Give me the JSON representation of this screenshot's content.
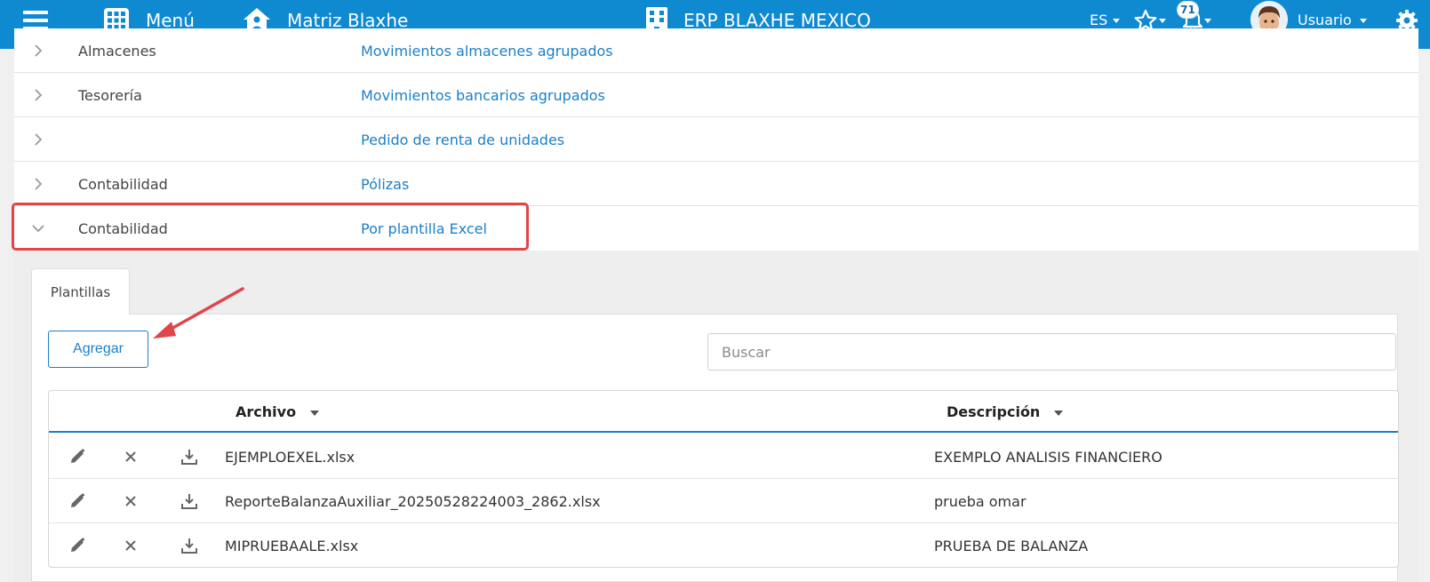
{
  "header": {
    "menu_label": "Menú",
    "company": "Matriz Blaxhe",
    "erp_title": "ERP BLAXHE MEXICO",
    "language": "ES",
    "notifications_count": "71",
    "user_label": "Usuario",
    "bar_color": "#0f89d0"
  },
  "menu_rows": [
    {
      "module": "Almacenes",
      "link": "Movimientos almacenes agrupados"
    },
    {
      "module": "Tesorería",
      "link": "Movimientos bancarios agrupados"
    },
    {
      "module": "",
      "link": "Pedido de renta de unidades"
    },
    {
      "module": "Contabilidad",
      "link": "Pólizas"
    },
    {
      "module": "Contabilidad",
      "link": "Por plantilla Excel",
      "expanded": true
    }
  ],
  "panel": {
    "tab_label": "Plantillas",
    "add_button": "Agregar",
    "search_placeholder": "Buscar"
  },
  "table": {
    "columns": [
      "Archivo",
      "Descripción"
    ],
    "rows": [
      {
        "archivo": "EJEMPLOEXEL.xlsx",
        "descripcion": "EXEMPLO ANALISIS FINANCIERO"
      },
      {
        "archivo": "ReporteBalanzaAuxiliar_20250528224003_2862.xlsx",
        "descripcion": "prueba omar"
      },
      {
        "archivo": "MIPRUEBAALE.xlsx",
        "descripcion": "PRUEBA DE BALANZA"
      }
    ],
    "row_icons": [
      "pencil-icon",
      "close-icon",
      "download-icon"
    ]
  },
  "colors": {
    "link": "#1c7fc8",
    "highlight": "#e0454a"
  }
}
